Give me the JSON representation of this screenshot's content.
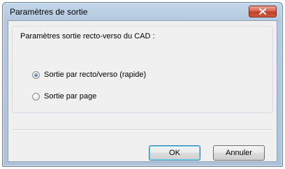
{
  "window": {
    "title": "Paramètres de sortie",
    "close_icon": "close-icon"
  },
  "group": {
    "label": "Paramètres sortie recto-verso du CAD :"
  },
  "options": [
    {
      "label": "Sortie par recto/verso (rapide)",
      "checked": true
    },
    {
      "label": "Sortie par page",
      "checked": false
    }
  ],
  "buttons": {
    "ok": "OK",
    "cancel": "Annuler"
  },
  "colors": {
    "title_bar": "#b9cde3",
    "close_button": "#c7472c",
    "client_background": "#f0f0f0",
    "default_button_border": "#3c7fb1"
  }
}
